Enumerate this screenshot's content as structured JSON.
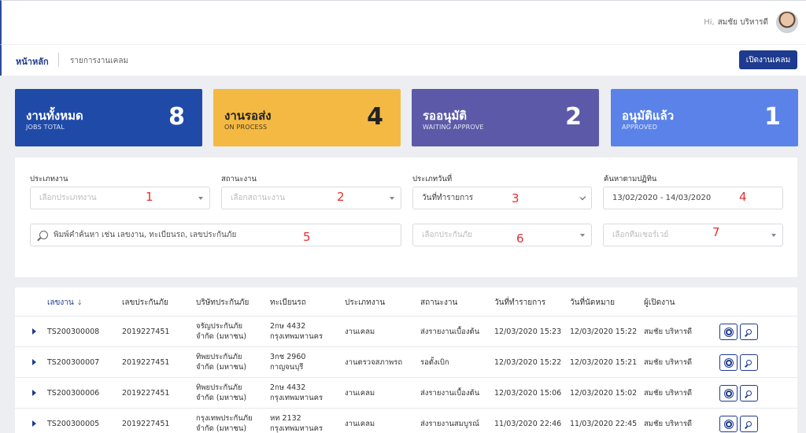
{
  "header": {
    "greeting_prefix": "Hi,",
    "user_name": "สมชัย บริหารดี"
  },
  "nav": {
    "home": "หน้าหลัก",
    "list": "รายการงานเคลม",
    "open_job": "เปิดงานเคลม"
  },
  "cards": [
    {
      "title": "งานทั้งหมด",
      "subtitle": "JOBS TOTAL",
      "count": "8",
      "color": "#1f4aa8"
    },
    {
      "title": "งานรอส่ง",
      "subtitle": "ON PROCESS",
      "count": "4",
      "color": "#f4b942"
    },
    {
      "title": "รออนุมัติ",
      "subtitle": "WAITING APPROVE",
      "count": "2",
      "color": "#5c5aa8"
    },
    {
      "title": "อนุมัติแล้ว",
      "subtitle": "APPROVED",
      "count": "1",
      "color": "#5b82e8"
    }
  ],
  "filters": {
    "job_type_label": "ประเภทงาน",
    "job_type_placeholder": "เลือกประเภทงาน",
    "job_status_label": "สถานะงาน",
    "job_status_placeholder": "เลือกสถานะงาน",
    "date_type_label": "ประเภทวันที่",
    "date_type_value": "วันที่ทำรายการ",
    "calendar_label": "ค้นหาตามปฏิทิน",
    "calendar_value": "13/02/2020 - 14/03/2020",
    "search_placeholder": "พิมพ์คำค้นหา เช่น เลขงาน, ทะเบียนรถ, เลขประกันภัย",
    "insurer_placeholder": "เลือกประกันภัย",
    "surveyor_placeholder": "เลือกทีมเซอร์เวย์",
    "markers": [
      "1",
      "2",
      "3",
      "4",
      "5",
      "6",
      "7"
    ]
  },
  "table": {
    "columns": [
      "เลขงาน",
      "เลขประกันภัย",
      "บริษัทประกันภัย",
      "ทะเบียนรถ",
      "ประเภทงาน",
      "สถานะงาน",
      "วันที่ทำรายการ",
      "วันที่นัดหมาย",
      "ผู้เปิดงาน"
    ],
    "sort_arrow": "🡓",
    "rows": [
      {
        "job_no": "TS200300008",
        "policy": "2019227451",
        "insurer1": "จรัญประกันภัย",
        "insurer2": "จำกัด (มหาชน)",
        "plate1": "2กษ 4432",
        "plate2": "กรุงเทพมหานคร",
        "type": "งานเคลม",
        "status": "ส่งรายงานเบื้องต้น",
        "created": "12/03/2020 15:23",
        "appointment": "12/03/2020 15:22",
        "opener": "สมชัย บริหารดี"
      },
      {
        "job_no": "TS200300007",
        "policy": "2019227451",
        "insurer1": "ทิพยประกันภัย",
        "insurer2": "จำกัด (มหาชน)",
        "plate1": "3กช 2960",
        "plate2": "กาญจนบุรี",
        "type": "งานตรวจสภาพรถ",
        "status": "รอตั้งเบิก",
        "created": "12/03/2020 15:22",
        "appointment": "12/03/2020 15:21",
        "opener": "สมชัย บริหารดี"
      },
      {
        "job_no": "TS200300006",
        "policy": "2019227451",
        "insurer1": "ทิพยประกันภัย",
        "insurer2": "จำกัด (มหาชน)",
        "plate1": "2กษ 4432",
        "plate2": "กรุงเทพมหานคร",
        "type": "งานเคลม",
        "status": "ส่งรายงานเบื้องต้น",
        "created": "12/03/2020 15:06",
        "appointment": "12/03/2020 15:02",
        "opener": "สมชัย บริหารดี"
      },
      {
        "job_no": "TS200300005",
        "policy": "2019227451",
        "insurer1": "กรุงเทพประกันภัย",
        "insurer2": "จำกัด (มหาชน)",
        "plate1": "หท 2132",
        "plate2": "กรุงเทพมหานคร",
        "type": "งานเคลม",
        "status": "ส่งรายงานสมบูรณ์",
        "created": "11/03/2020 22:46",
        "appointment": "11/03/2020 22:45",
        "opener": "สมชัย บริหารดี"
      }
    ]
  }
}
